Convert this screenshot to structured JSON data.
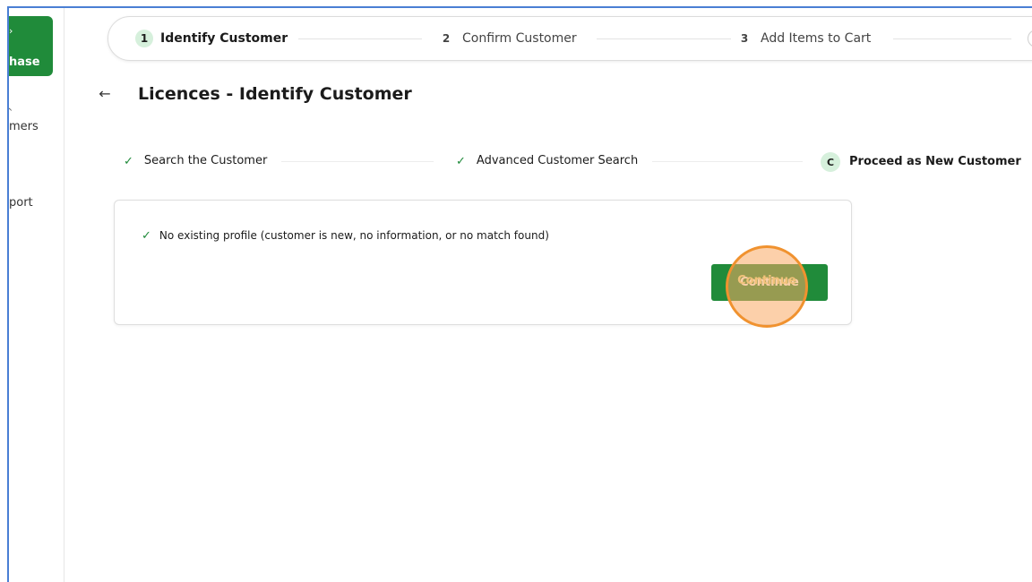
{
  "sidebar": {
    "purchase": {
      "icon": "arrow-icon",
      "label": "hase"
    },
    "items": [
      {
        "icon": "chevron-up-icon",
        "label": "mers"
      },
      {
        "icon": "help-icon",
        "label": "port"
      }
    ]
  },
  "stepper": {
    "steps": [
      {
        "number": "1",
        "label": "Identify Customer",
        "active": true
      },
      {
        "number": "2",
        "label": "Confirm Customer",
        "active": false
      },
      {
        "number": "3",
        "label": "Add Items to Cart",
        "active": false
      }
    ]
  },
  "header": {
    "back_icon": "←",
    "title": "Licences - Identify Customer"
  },
  "substeps": [
    {
      "icon": "✓",
      "label": "Search the Customer"
    },
    {
      "icon": "✓",
      "label": "Advanced Customer Search"
    },
    {
      "badge": "C",
      "label": "Proceed as New Customer"
    }
  ],
  "card": {
    "check_icon": "✓",
    "message": "No existing profile (customer is new, no information, or no match found)",
    "continue_label": "Continue"
  },
  "colors": {
    "primary_green": "#208b3a",
    "light_green": "#d6f0dc",
    "highlight_orange": "#f0922f"
  }
}
